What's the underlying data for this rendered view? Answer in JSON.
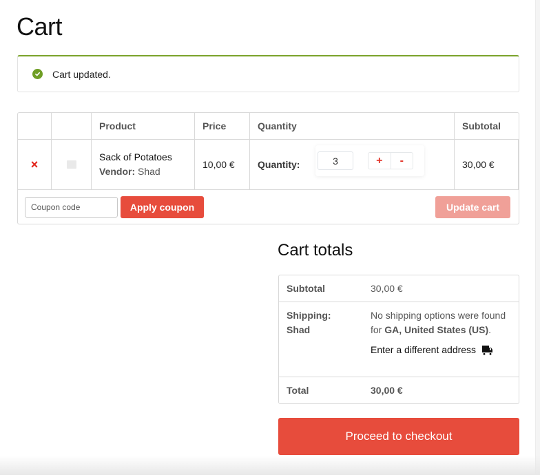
{
  "page": {
    "title": "Cart"
  },
  "notice": {
    "icon": "check-circle-icon",
    "message": "Cart updated.",
    "accent": "#7ba32b"
  },
  "cart_table": {
    "headers": [
      "",
      "",
      "Product",
      "Price",
      "Quantity",
      "Subtotal"
    ],
    "items": [
      {
        "remove_icon": "×",
        "product_name": "Sack of Potatoes",
        "vendor_label": "Vendor:",
        "vendor_name": "Shad",
        "price": "10,00 €",
        "quantity_label": "Quantity:",
        "quantity": "3",
        "plus": "+",
        "minus": "-",
        "subtotal": "30,00 €"
      }
    ],
    "coupon_placeholder": "Coupon code",
    "apply_coupon_label": "Apply coupon",
    "update_cart_label": "Update cart"
  },
  "totals": {
    "title": "Cart totals",
    "subtotal_label": "Subtotal",
    "subtotal_value": "30,00 €",
    "shipping_label": "Shipping:",
    "shipping_vendor": "Shad",
    "shipping_msg_pre": "No shipping options were found for ",
    "shipping_msg_bold": "GA, United States (US)",
    "shipping_msg_post": ".",
    "different_address": "Enter a different address",
    "total_label": "Total",
    "total_value": "30,00 €"
  },
  "checkout": {
    "label": "Proceed to checkout"
  },
  "colors": {
    "brand_red": "#e74c3c",
    "update_disabled": "#f0a098",
    "success_green": "#6f9e25"
  }
}
